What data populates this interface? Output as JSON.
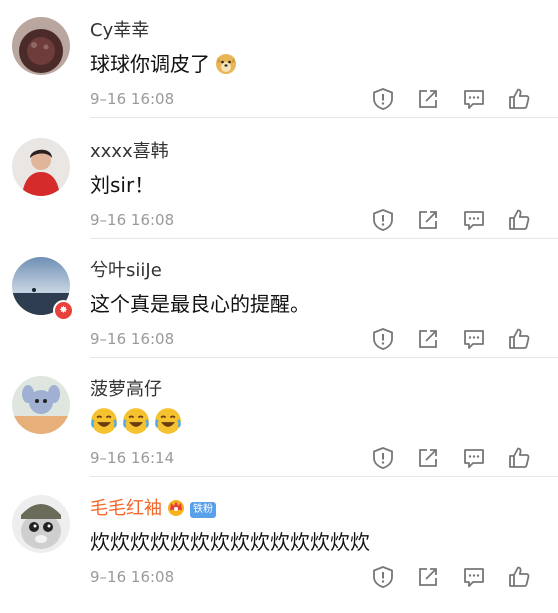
{
  "comments": [
    {
      "username": "Cy幸幸",
      "text": "球球你调皮了",
      "time": "9–16 16:08",
      "icon": "doge-emoji"
    },
    {
      "username": "xxxx喜韩",
      "text": "刘sir！",
      "time": "9–16 16:08"
    },
    {
      "username": "兮叶siiJe",
      "text": "这个真是最良心的提醒。",
      "time": "9–16 16:08",
      "badge": "verified-badge"
    },
    {
      "username": "菠萝高仔",
      "text": "",
      "time": "9–16 16:14",
      "icon": "laughing-emoji"
    },
    {
      "username": "毛毛红袖",
      "text": "炊炊炊炊炊炊炊炊炊炊炊炊炊炊",
      "time": "9–16 16:08",
      "fan_badge": "铁粉",
      "icon": "crown-icon",
      "name_color": "#f5672a"
    }
  ],
  "actions": [
    "report-icon",
    "share-icon",
    "reply-icon",
    "like-icon"
  ],
  "colors": {
    "timestamp": "#9a9a9a",
    "vip_name": "#f5672a",
    "fan_badge": "#5aa0e8"
  }
}
